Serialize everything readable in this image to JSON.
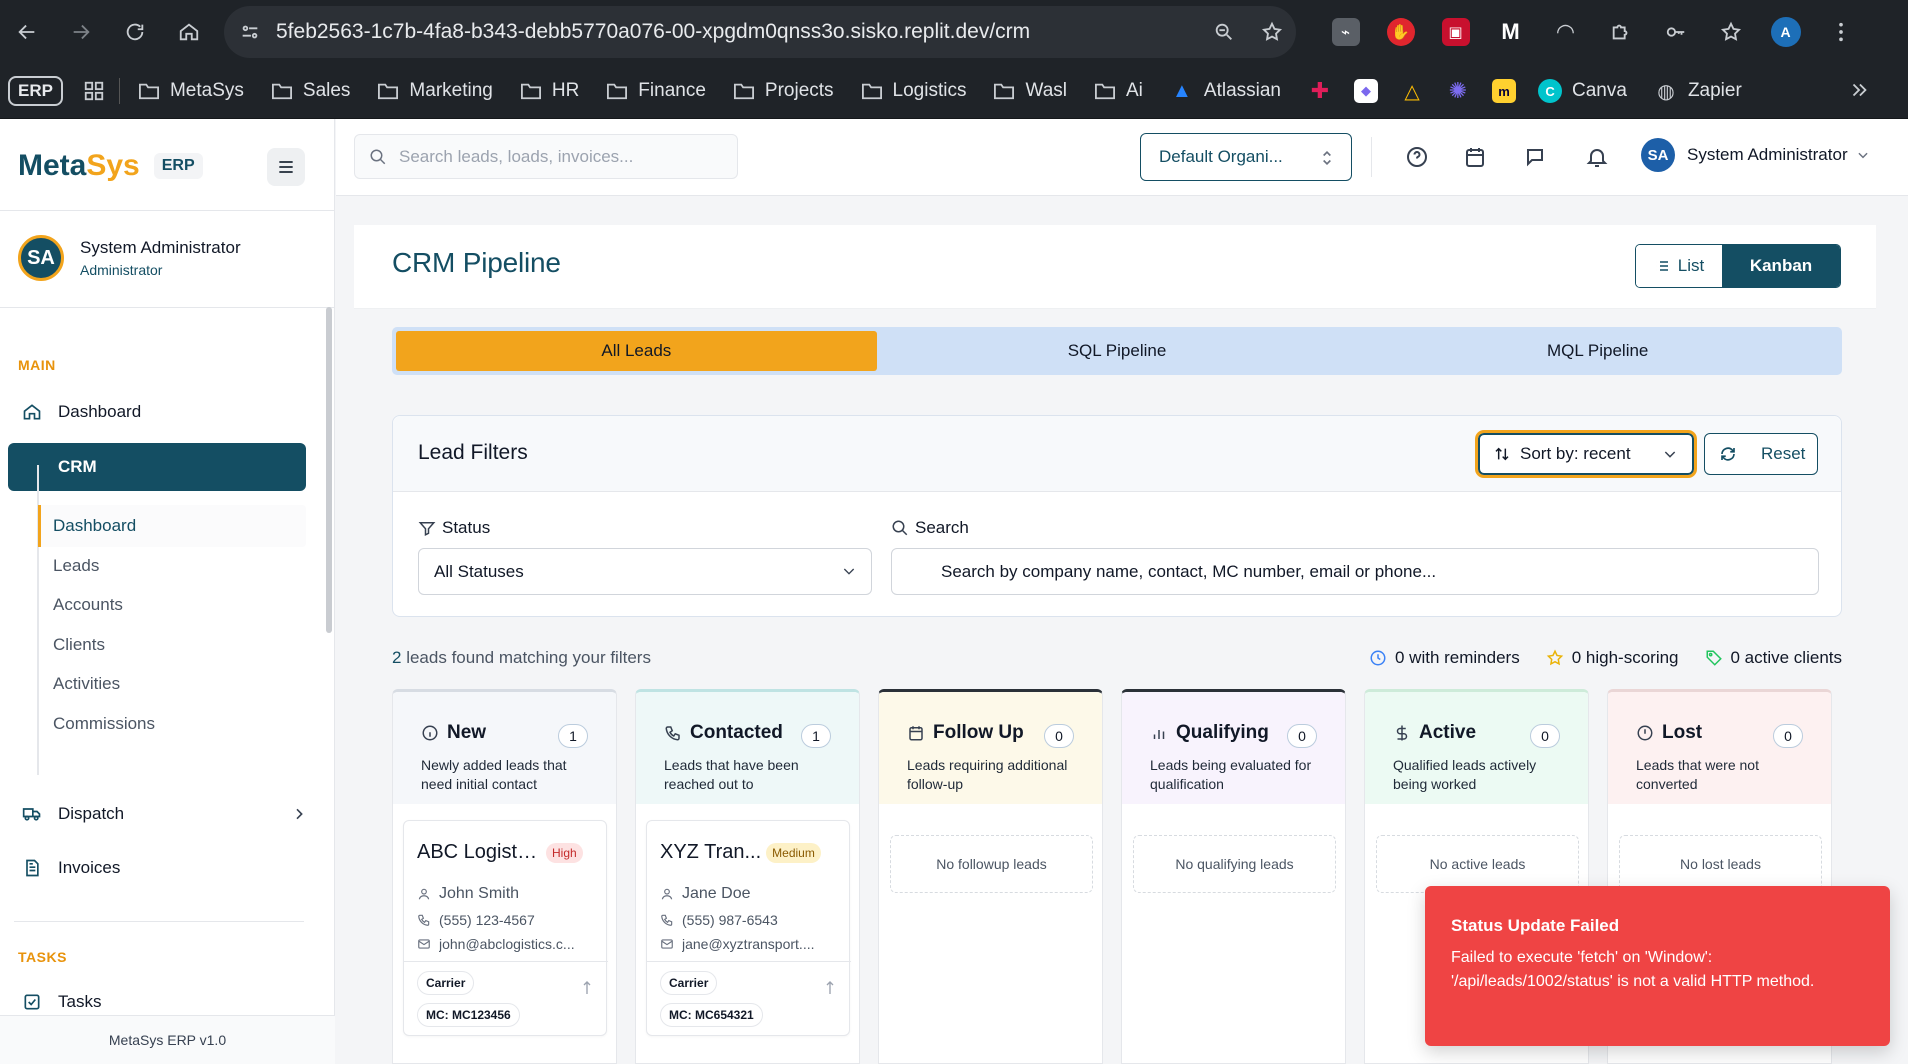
{
  "browser": {
    "url": "5feb2563-1c7b-4fa8-b343-debb5770a076-00-xpgdm0qnss3o.sisko.replit.dev/crm",
    "bookmarks": {
      "erp_badge": "ERP",
      "folders": [
        "MetaSys",
        "Sales",
        "Marketing",
        "HR",
        "Finance",
        "Projects",
        "Logistics",
        "Wasl",
        "Ai"
      ],
      "atlassian": "Atlassian",
      "canva": "Canva",
      "zapier": "Zapier"
    },
    "profile_initial": "A"
  },
  "sidebar": {
    "brand_meta": "Meta",
    "brand_sys": "Sys",
    "brand_erp": "ERP",
    "user": {
      "initials": "SA",
      "name": "System Administrator",
      "role": "Administrator"
    },
    "sections": {
      "main": "MAIN",
      "tasks": "TASKS"
    },
    "items": {
      "dashboard": "Dashboard",
      "crm": "CRM",
      "dispatch": "Dispatch",
      "invoices": "Invoices",
      "tasks": "Tasks"
    },
    "crm_sub": [
      "Dashboard",
      "Leads",
      "Accounts",
      "Clients",
      "Activities",
      "Commissions"
    ],
    "footer": "MetaSys ERP v1.0"
  },
  "header": {
    "search_placeholder": "Search leads, loads, invoices...",
    "org_label": "Default Organi...",
    "user": {
      "initials": "SA",
      "name": "System Administrator"
    }
  },
  "main": {
    "title": "CRM Pipeline",
    "view_list": "List",
    "view_kanban": "Kanban",
    "tabs": [
      "All Leads",
      "SQL Pipeline",
      "MQL Pipeline"
    ],
    "filters": {
      "title": "Lead Filters",
      "sort_label": "Sort by: recent",
      "reset_label": "Reset",
      "status_label": "Status",
      "status_value": "All Statuses",
      "search_label": "Search",
      "search_placeholder": "Search by company name, contact, MC number, email or phone..."
    },
    "summary": {
      "count": "2",
      "text": "leads found matching your filters",
      "reminders": "0 with reminders",
      "high_scoring": "0 high-scoring",
      "active_clients": "0 active clients"
    },
    "columns": [
      {
        "title": "New",
        "count": "1",
        "desc": "Newly added leads that need initial contact",
        "color": "#f5f7fa",
        "border": "#d7dce3"
      },
      {
        "title": "Contacted",
        "count": "1",
        "desc": "Leads that have been reached out to",
        "color": "#eef8f8",
        "border": "#bfe3e3"
      },
      {
        "title": "Follow Up",
        "count": "0",
        "desc": "Leads requiring additional follow-up",
        "color": "#fdf9e9",
        "border": "#2b3138",
        "empty": "No followup leads"
      },
      {
        "title": "Qualifying",
        "count": "0",
        "desc": "Leads being evaluated for qualification",
        "color": "#f8f3fd",
        "border": "#2b3138",
        "empty": "No qualifying leads"
      },
      {
        "title": "Active",
        "count": "0",
        "desc": "Qualified leads actively being worked",
        "color": "#ecfaf3",
        "border": "#cdebd9",
        "empty": "No active leads"
      },
      {
        "title": "Lost",
        "count": "0",
        "desc": "Leads that were not converted",
        "color": "#fdf1f1",
        "border": "#ead6d6",
        "empty": "No lost leads"
      }
    ],
    "leads": [
      {
        "company": "ABC Logistics",
        "priority": "High",
        "contact": "John Smith",
        "phone": "(555) 123-4567",
        "email": "john@abclogistics.c...",
        "type": "Carrier",
        "mc": "MC: MC123456"
      },
      {
        "company": "XYZ Tran...",
        "priority": "Medium",
        "contact": "Jane Doe",
        "phone": "(555) 987-6543",
        "email": "jane@xyztransport....",
        "type": "Carrier",
        "mc": "MC: MC654321"
      }
    ]
  },
  "toast": {
    "title": "Status Update Failed",
    "message": "Failed to execute 'fetch' on 'Window': '/api/leads/1002/status' is not a valid HTTP method."
  }
}
